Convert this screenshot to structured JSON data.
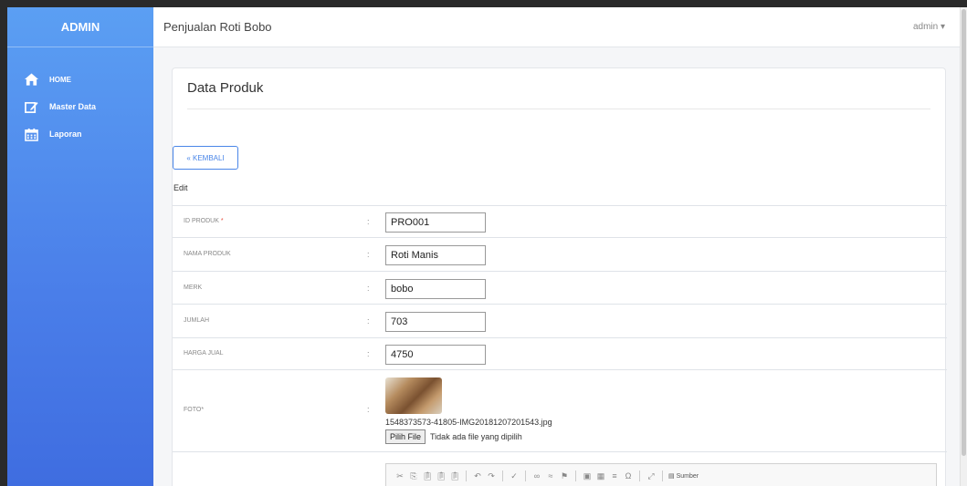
{
  "sidebar": {
    "brand": "ADMIN",
    "items": [
      {
        "label": "HOME",
        "icon": "home-icon"
      },
      {
        "label": "Master Data",
        "icon": "edit-icon"
      },
      {
        "label": "Laporan",
        "icon": "calendar-icon"
      }
    ]
  },
  "topbar": {
    "title": "Penjualan Roti Bobo",
    "user": "admin ▾"
  },
  "main": {
    "card_title": "Data Produk",
    "back_button": "« KEMBALI",
    "edit_label": "Edit",
    "colon": ":",
    "fields": {
      "id_produk": {
        "label": "ID PRODUK",
        "required_mark": "*",
        "value": "PRO001"
      },
      "nama_produk": {
        "label": "NAMA PRODUK",
        "value": "Roti Manis"
      },
      "merk": {
        "label": "MERK",
        "value": "bobo"
      },
      "jumlah": {
        "label": "JUMLAH",
        "value": "703"
      },
      "harga_jual": {
        "label": "HARGA JUAL",
        "value": "4750"
      }
    },
    "foto": {
      "label": "FOTO*",
      "filename": "1548373573-41805-IMG20181207201543.jpg",
      "choose_button": "Pilih File",
      "status": "Tidak ada file yang dipilih"
    },
    "editor": {
      "source_label": "Sumber"
    }
  },
  "colors": {
    "sidebar_top": "#5b9ff3",
    "sidebar_bottom": "#3f6de0",
    "accent": "#4a86e8",
    "required": "#e74c3c"
  }
}
